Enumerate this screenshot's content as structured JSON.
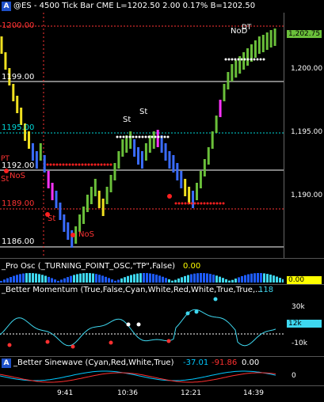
{
  "header": {
    "symbol_line": "@ES - 4500 Tick Bar  CME  L=1202.50  2.00   0.17%   B=1202.50",
    "icon_letter": "A"
  },
  "price_axis": {
    "labels": [
      "1,200.00",
      "1,195.00",
      "1,190.00"
    ],
    "current_price_tag": "1,202.75"
  },
  "price_levels": [
    {
      "label": "1200.00",
      "color": "#ff3333"
    },
    {
      "label": "1199.00",
      "color": "#ffffff"
    },
    {
      "label": "1195.00",
      "color": "#00d8d8"
    },
    {
      "label": "1192.00",
      "color": "#ffffff"
    },
    {
      "label": "1189.00",
      "color": "#ff3333"
    },
    {
      "label": "1186.00",
      "color": "#ffffff"
    }
  ],
  "chart_annotations": {
    "st": "St",
    "nos": "NoS",
    "pt": "PT",
    "nod": "NoD",
    "dt": "DT"
  },
  "panels": {
    "pro_osc": {
      "label": "_Pro Osc (_TURNING_POINT_OSC,\"TP\",False)",
      "value": "0.00",
      "axis_value": "0.00"
    },
    "better_momentum": {
      "label": "_Better Momentum (True,False,Cyan,White,Red,White,True,True,...",
      "value": "118",
      "axis_labels": [
        "30k",
        "-10k"
      ],
      "current_tag": "12k"
    },
    "better_sinewave": {
      "icon_letter": "A",
      "label": "_Better Sinewave (Cyan,Red,White,True)",
      "value1": "-37.01",
      "value2": "-91.86",
      "value3": "0.00",
      "axis_label": "0"
    }
  },
  "time_axis": {
    "labels": [
      "9:41",
      "10:36",
      "12:21",
      "14:39"
    ]
  },
  "colors": {
    "background": "#000000",
    "bar_up": "#6abf3a",
    "bar_down": "#3a6cff",
    "bar_neutral": "#f0e020",
    "bar_magenta": "#ff33ff",
    "support_dots": "#ff2020",
    "resistance_dots": "#ffffff",
    "momentum_line": "#3ed8f0",
    "sine_cyan": "#00c8ff",
    "sine_red": "#ff3030"
  }
}
